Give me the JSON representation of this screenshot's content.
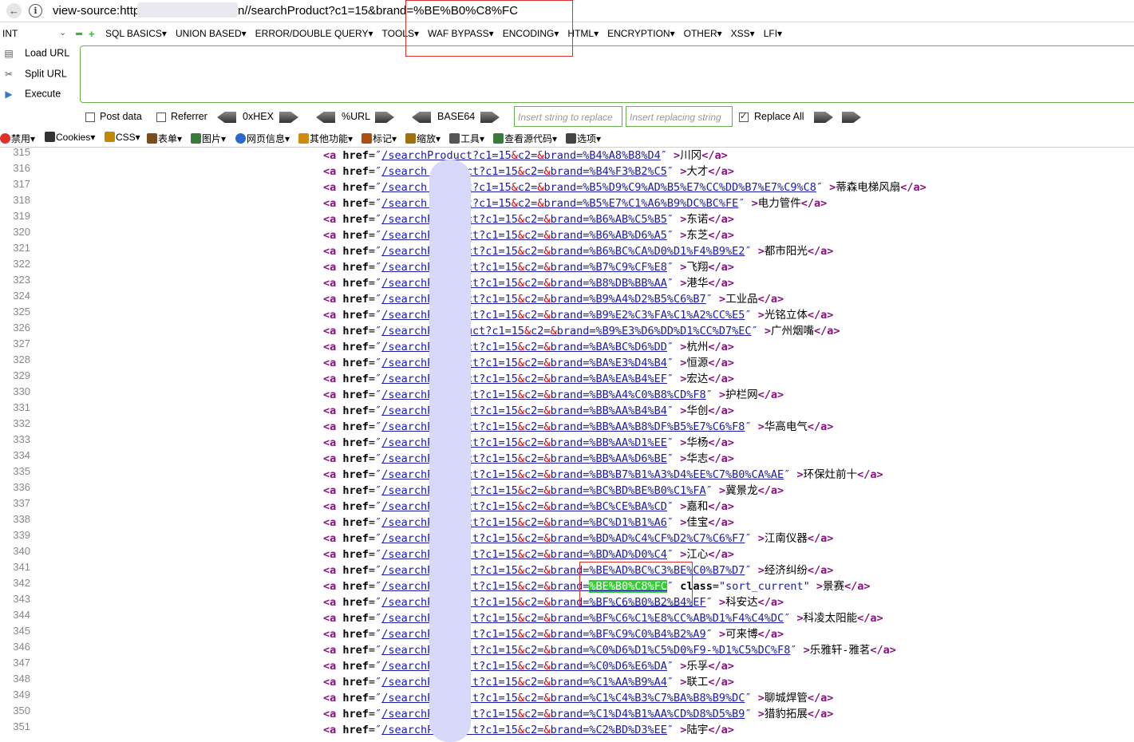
{
  "address_bar": {
    "url_prefix": "view-source:http",
    "url_suffix": "n//searchProduct?c1=15&brand=%BE%B0%C8%FC"
  },
  "hackbar": {
    "select_value": "INT",
    "menu": [
      "SQL BASICS▾",
      "UNION BASED▾",
      "ERROR/DOUBLE QUERY▾",
      "TOOLS▾",
      "WAF BYPASS▾",
      "ENCODING▾",
      "HTML▾",
      "ENCRYPTION▾",
      "OTHER▾",
      "XSS▾",
      "LFI▾"
    ],
    "load_url": "Load URL",
    "split_url": "Split URL",
    "execute": "Execute",
    "post_data": "Post data",
    "referrer": "Referrer",
    "hex": "0xHEX",
    "url": "%URL",
    "base64": "BASE64",
    "insert_placeholder": "Insert string to replace",
    "replacing_placeholder": "Insert replacing string",
    "replace_all": "Replace All"
  },
  "webdev_toolbar": [
    "禁用▾",
    "Cookies▾",
    "CSS▾",
    "表单▾",
    "图片▾",
    "网页信息▾",
    "其他功能▾",
    "标记▾",
    "缩放▾",
    "工具▾",
    "查看源代码▾",
    "选项▾"
  ],
  "source": {
    "lines": [
      {
        "n": "315",
        "pre": "/searchProduct?c1=15",
        "brand": "%B4%A8%B8%D4",
        "text": "川冈"
      },
      {
        "n": "316",
        "pre": "/search",
        "post": "duct?c1=15",
        "brand": "%B4%F3%B2%C5",
        "text": "大才"
      },
      {
        "n": "317",
        "pre": "/search",
        "post": "uct?c1=15",
        "brand": "%B5%D9%C9%AD%B5%E7%CC%DD%B7%E7%C9%C8",
        "text": "蒂森电梯风扇"
      },
      {
        "n": "318",
        "pre": "/search",
        "post": "uct?c1=15",
        "brand": "%B5%E7%C1%A6%B9%DC%BC%FE",
        "text": "电力管件"
      },
      {
        "n": "319",
        "pre": "/searchP",
        "post": "uct?c1=15",
        "brand": "%B6%AB%C5%B5",
        "text": "东诺"
      },
      {
        "n": "320",
        "pre": "/searchP",
        "post": "uct?c1=15",
        "brand": "%B6%AB%D6%A5",
        "text": "东芝"
      },
      {
        "n": "321",
        "pre": "/searchP",
        "post": "uct?c1=15",
        "brand": "%B6%BC%CA%D0%D1%F4%B9%E2",
        "text": "都市阳光"
      },
      {
        "n": "322",
        "pre": "/searchP",
        "post": "uct?c1=15",
        "brand": "%B7%C9%CF%E8",
        "text": "飞翔"
      },
      {
        "n": "323",
        "pre": "/searchP",
        "post": "uct?c1=15",
        "brand": "%B8%DB%BB%AA",
        "text": "港华"
      },
      {
        "n": "324",
        "pre": "/searchP",
        "post": "uct?c1=15",
        "brand": "%B9%A4%D2%B5%C6%B7",
        "text": "工业品"
      },
      {
        "n": "325",
        "pre": "/searchP",
        "post": "uct?c1=15",
        "brand": "%B9%E2%C3%FA%C1%A2%CC%E5",
        "text": "光铭立体"
      },
      {
        "n": "326",
        "pre": "/searchPr",
        "post": "uct?c1=15",
        "brand": "%B9%E3%D6%DD%D1%CC%D7%EC",
        "text": "广州烟嘴"
      },
      {
        "n": "327",
        "pre": "/searchPr",
        "post": "ct?c1=15",
        "brand": "%BA%BC%D6%DD",
        "text": "杭州"
      },
      {
        "n": "328",
        "pre": "/searchPr",
        "post": "ct?c1=15",
        "brand": "%BA%E3%D4%B4",
        "text": "恒源"
      },
      {
        "n": "329",
        "pre": "/searchPr",
        "post": "ct?c1=15",
        "brand": "%BA%EA%B4%EF",
        "text": "宏达"
      },
      {
        "n": "330",
        "pre": "/searchPr",
        "post": "ct?c1=15",
        "brand": "%BB%A4%C0%B8%CD%F8",
        "text": "护栏网"
      },
      {
        "n": "331",
        "pre": "/searchPr",
        "post": "ct?c1=15",
        "brand": "%BB%AA%B4%B4",
        "text": "华创"
      },
      {
        "n": "332",
        "pre": "/searchPr",
        "post": "ct?c1=15",
        "brand": "%BB%AA%B8%DF%B5%E7%C6%F8",
        "text": "华高电气"
      },
      {
        "n": "333",
        "pre": "/searchPr",
        "post": "ct?c1=15",
        "brand": "%BB%AA%D1%EE",
        "text": "华杨"
      },
      {
        "n": "334",
        "pre": "/searchPr",
        "post": "ct?c1=15",
        "brand": "%BB%AA%D6%BE",
        "text": "华志"
      },
      {
        "n": "335",
        "pre": "/searchPr",
        "post": "ct?c1=15",
        "brand": "%BB%B7%B1%A3%D4%EE%C7%B0%CA%AE",
        "text": "环保灶前十"
      },
      {
        "n": "336",
        "pre": "/searchPr",
        "post": "ct?c1=15",
        "brand": "%BC%BD%BE%B0%C1%FA",
        "text": "冀景龙"
      },
      {
        "n": "337",
        "pre": "/searchPr",
        "post": "ct?c1=15",
        "brand": "%BC%CE%BA%CD",
        "text": "嘉和"
      },
      {
        "n": "338",
        "pre": "/searchPr",
        "post": "ct?c1=15",
        "brand": "%BC%D1%B1%A6",
        "text": "佳宝"
      },
      {
        "n": "339",
        "pre": "/searchPro",
        "post": "t?c1=15",
        "brand": "%BD%AD%C4%CF%D2%C7%C6%F7",
        "text": "江南仪器"
      },
      {
        "n": "340",
        "pre": "/searchPro",
        "post": "t?c1=15",
        "brand": "%BD%AD%D0%C4",
        "text": "江心"
      },
      {
        "n": "341",
        "pre": "/searchPro",
        "post": "t?c1=15",
        "brand": "%BE%AD%BC%C3%BE%C0%B7%D7",
        "text": "经济纠纷"
      },
      {
        "n": "342",
        "pre": "/searchPro",
        "post": "t?c1=15",
        "brand": "%BE%B0%C8%FC",
        "text": "景赛",
        "current": true
      },
      {
        "n": "343",
        "pre": "/searchPro",
        "post": "t?c1=15",
        "brand": "%BF%C6%B0%B2%B4%EF",
        "text": "科安达"
      },
      {
        "n": "344",
        "pre": "/searchPro",
        "post": "t?c1=15",
        "brand": "%BF%C6%C1%E8%CC%AB%D1%F4%C4%DC",
        "text": "科凌太阳能"
      },
      {
        "n": "345",
        "pre": "/searchPro",
        "post": "t?c1=15",
        "brand": "%BF%C9%C0%B4%B2%A9",
        "text": "可来博"
      },
      {
        "n": "346",
        "pre": "/searchPro",
        "post": "t?c1=15",
        "brand": "%C0%D6%D1%C5%D0%F9-%D1%C5%DC%F8",
        "text": "乐雅轩-雅茗"
      },
      {
        "n": "347",
        "pre": "/searchPro",
        "post": "t?c1=15",
        "brand": "%C0%D6%E6%DA",
        "text": "乐孚"
      },
      {
        "n": "348",
        "pre": "/searchPro",
        "post": "t?c1=15",
        "brand": "%C1%AA%B9%A4",
        "text": "联工"
      },
      {
        "n": "349",
        "pre": "/searchPro",
        "post": "t?c1=15",
        "brand": "%C1%C4%B3%C7%BA%B8%B9%DC",
        "text": "聊城焊管"
      },
      {
        "n": "350",
        "pre": "/searchPro",
        "post": "t?c1=15",
        "brand": "%C1%D4%B1%AA%CD%D8%D5%B9",
        "text": "猎豹拓展"
      },
      {
        "n": "351",
        "pre": "/searchPro",
        "post": "t?c1=15",
        "brand": "%C2%BD%D3%EE",
        "text": "陆宇"
      }
    ],
    "current_class": "sort_current"
  }
}
